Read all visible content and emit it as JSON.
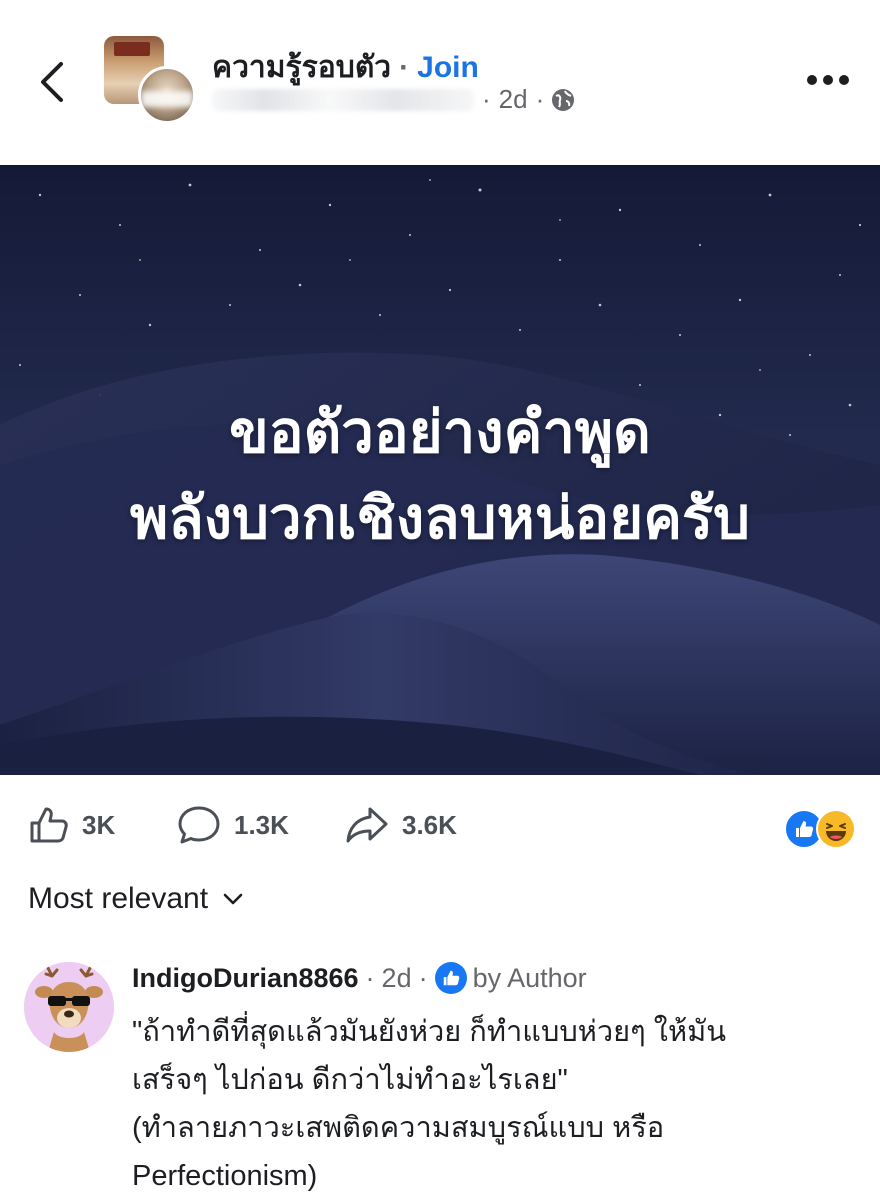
{
  "header": {
    "group_name": "ความรู้รอบตัว",
    "separator": "·",
    "join_label": "Join",
    "post_time": "2d",
    "meta_separator": "·",
    "icons": {
      "back": "back-chevron-icon",
      "privacy": "globe-icon",
      "more": "more-options-icon"
    }
  },
  "post": {
    "image_text_line1": "ขอตัวอย่างคำพูด",
    "image_text_line2": "พลังบวกเชิงลบหน่อยครับ"
  },
  "actions": {
    "like_count": "3K",
    "comment_count": "1.3K",
    "share_count": "3.6K",
    "reactions": [
      "like",
      "haha"
    ],
    "colors": {
      "like": "#1877f2",
      "haha": "#f7b928"
    }
  },
  "comments_section": {
    "sort_label": "Most relevant"
  },
  "comment": {
    "author": "IndigoDurian8866",
    "sep1": "·",
    "time": "2d",
    "sep2": "·",
    "badge_label": "by Author",
    "line1": "\"ถ้าทำดีที่สุดแล้วมันยังห่วย ก็ทำแบบห่วยๆ ให้มัน",
    "line2": "เสร็จๆ ไปก่อน ดีกว่าไม่ทำอะไรเลย\"",
    "line3": "(ทำลายภาวะเสพติดความสมบูรณ์แบบ หรือ",
    "line4": "Perfectionism)"
  },
  "colors": {
    "accent": "#1b74e4",
    "secondary_text": "#65676b",
    "night_sky": "#1a2040"
  }
}
